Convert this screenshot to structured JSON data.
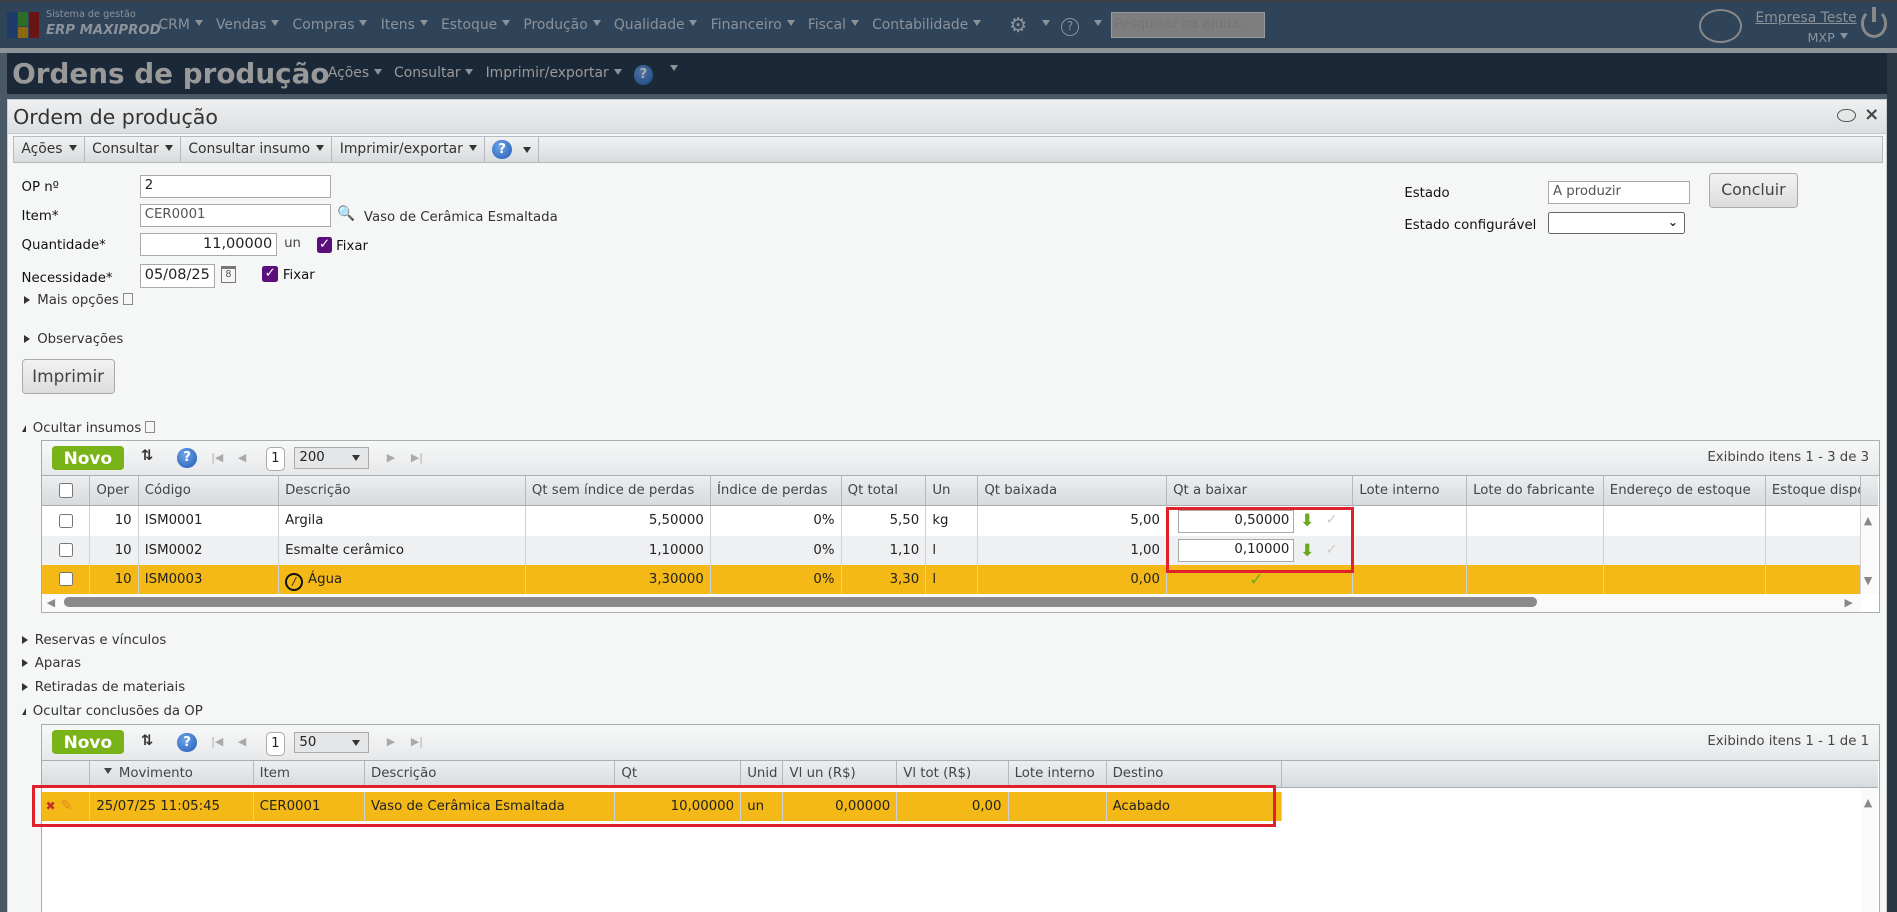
{
  "header": {
    "brand_line1": "Sistema de gestão",
    "brand_line2": "ERP MAXIPROD",
    "menu": [
      "CRM",
      "Vendas",
      "Compras",
      "Itens",
      "Estoque",
      "Produção",
      "Qualidade",
      "Financeiro",
      "Fiscal",
      "Contabilidade"
    ],
    "search_placeholder": "Pesquisar na ajuda...",
    "company": "Empresa Teste",
    "user": "MXP"
  },
  "page": {
    "title": "Ordens de produção",
    "menu": [
      "Ações",
      "Consultar",
      "Imprimir/exportar"
    ]
  },
  "panel": {
    "title": "Ordem de produção",
    "toolbar": [
      "Ações",
      "Consultar",
      "Consultar insumo",
      "Imprimir/exportar"
    ]
  },
  "form": {
    "op_label": "OP nº",
    "op_value": "2",
    "item_label": "Item*",
    "item_value": "CER0001",
    "item_desc": "Vaso de Cerâmica Esmaltada",
    "qty_label": "Quantidade*",
    "qty_value": "11,00000",
    "qty_unit": "un",
    "fixar": "Fixar",
    "need_label": "Necessidade*",
    "need_value": "05/08/25",
    "calendar_day": "8",
    "mais_opcoes": "Mais opções",
    "observacoes": "Observações",
    "imprimir": "Imprimir",
    "estado_label": "Estado",
    "estado_value": "A produzir",
    "concluir": "Concluir",
    "estado_conf_label": "Estado configurável",
    "estado_conf_value": ""
  },
  "insumos": {
    "toggle": "Ocultar insumos",
    "novo": "Novo",
    "page": "1",
    "page_size": "200",
    "status": "Exibindo itens 1 - 3 de 3",
    "columns": [
      "Oper",
      "Código",
      "Descrição",
      "Qt sem índice de perdas",
      "Índice de perdas",
      "Qt total",
      "Un",
      "Qt baixada",
      "Qt a baixar",
      "Lote interno",
      "Lote do fabricante",
      "Endereço de estoque",
      "Estoque disponível"
    ],
    "rows": [
      {
        "oper": "10",
        "codigo": "ISM0001",
        "descricao": "Argila",
        "qt_sem": "5,50000",
        "indice": "0%",
        "qt_total": "5,50",
        "un": "kg",
        "qt_baixada": "5,00",
        "qt_a_baixar": "0,50000"
      },
      {
        "oper": "10",
        "codigo": "ISM0002",
        "descricao": "Esmalte cerâmico",
        "qt_sem": "1,10000",
        "indice": "0%",
        "qt_total": "1,10",
        "un": "l",
        "qt_baixada": "1,00",
        "qt_a_baixar": "0,10000"
      },
      {
        "oper": "10",
        "codigo": "ISM0003",
        "descricao": "Água",
        "qt_sem": "3,30000",
        "indice": "0%",
        "qt_total": "3,30",
        "un": "l",
        "qt_baixada": "0,00",
        "qt_a_baixar": ""
      }
    ]
  },
  "sections": [
    "Reservas e vínculos",
    "Aparas",
    "Retiradas de materiais"
  ],
  "conclusoes": {
    "toggle": "Ocultar conclusões da OP",
    "novo": "Novo",
    "page": "1",
    "page_size": "50",
    "status": "Exibindo itens 1 - 1 de 1",
    "columns": [
      "Movimento",
      "Item",
      "Descrição",
      "Qt",
      "Unid",
      "Vl un (R$)",
      "Vl tot (R$)",
      "Lote interno",
      "Destino"
    ],
    "rows": [
      {
        "movimento": "25/07/25 11:05:45",
        "item": "CER0001",
        "descricao": "Vaso de Cerâmica Esmaltada",
        "qt": "10,00000",
        "unid": "un",
        "vl_un": "0,00000",
        "vl_tot": "0,00",
        "lote": "",
        "destino": "Acabado"
      }
    ]
  },
  "colors": {
    "highlight": "#f4b916",
    "accent_green": "#7ab317",
    "annotation_red": "#e0202a"
  }
}
